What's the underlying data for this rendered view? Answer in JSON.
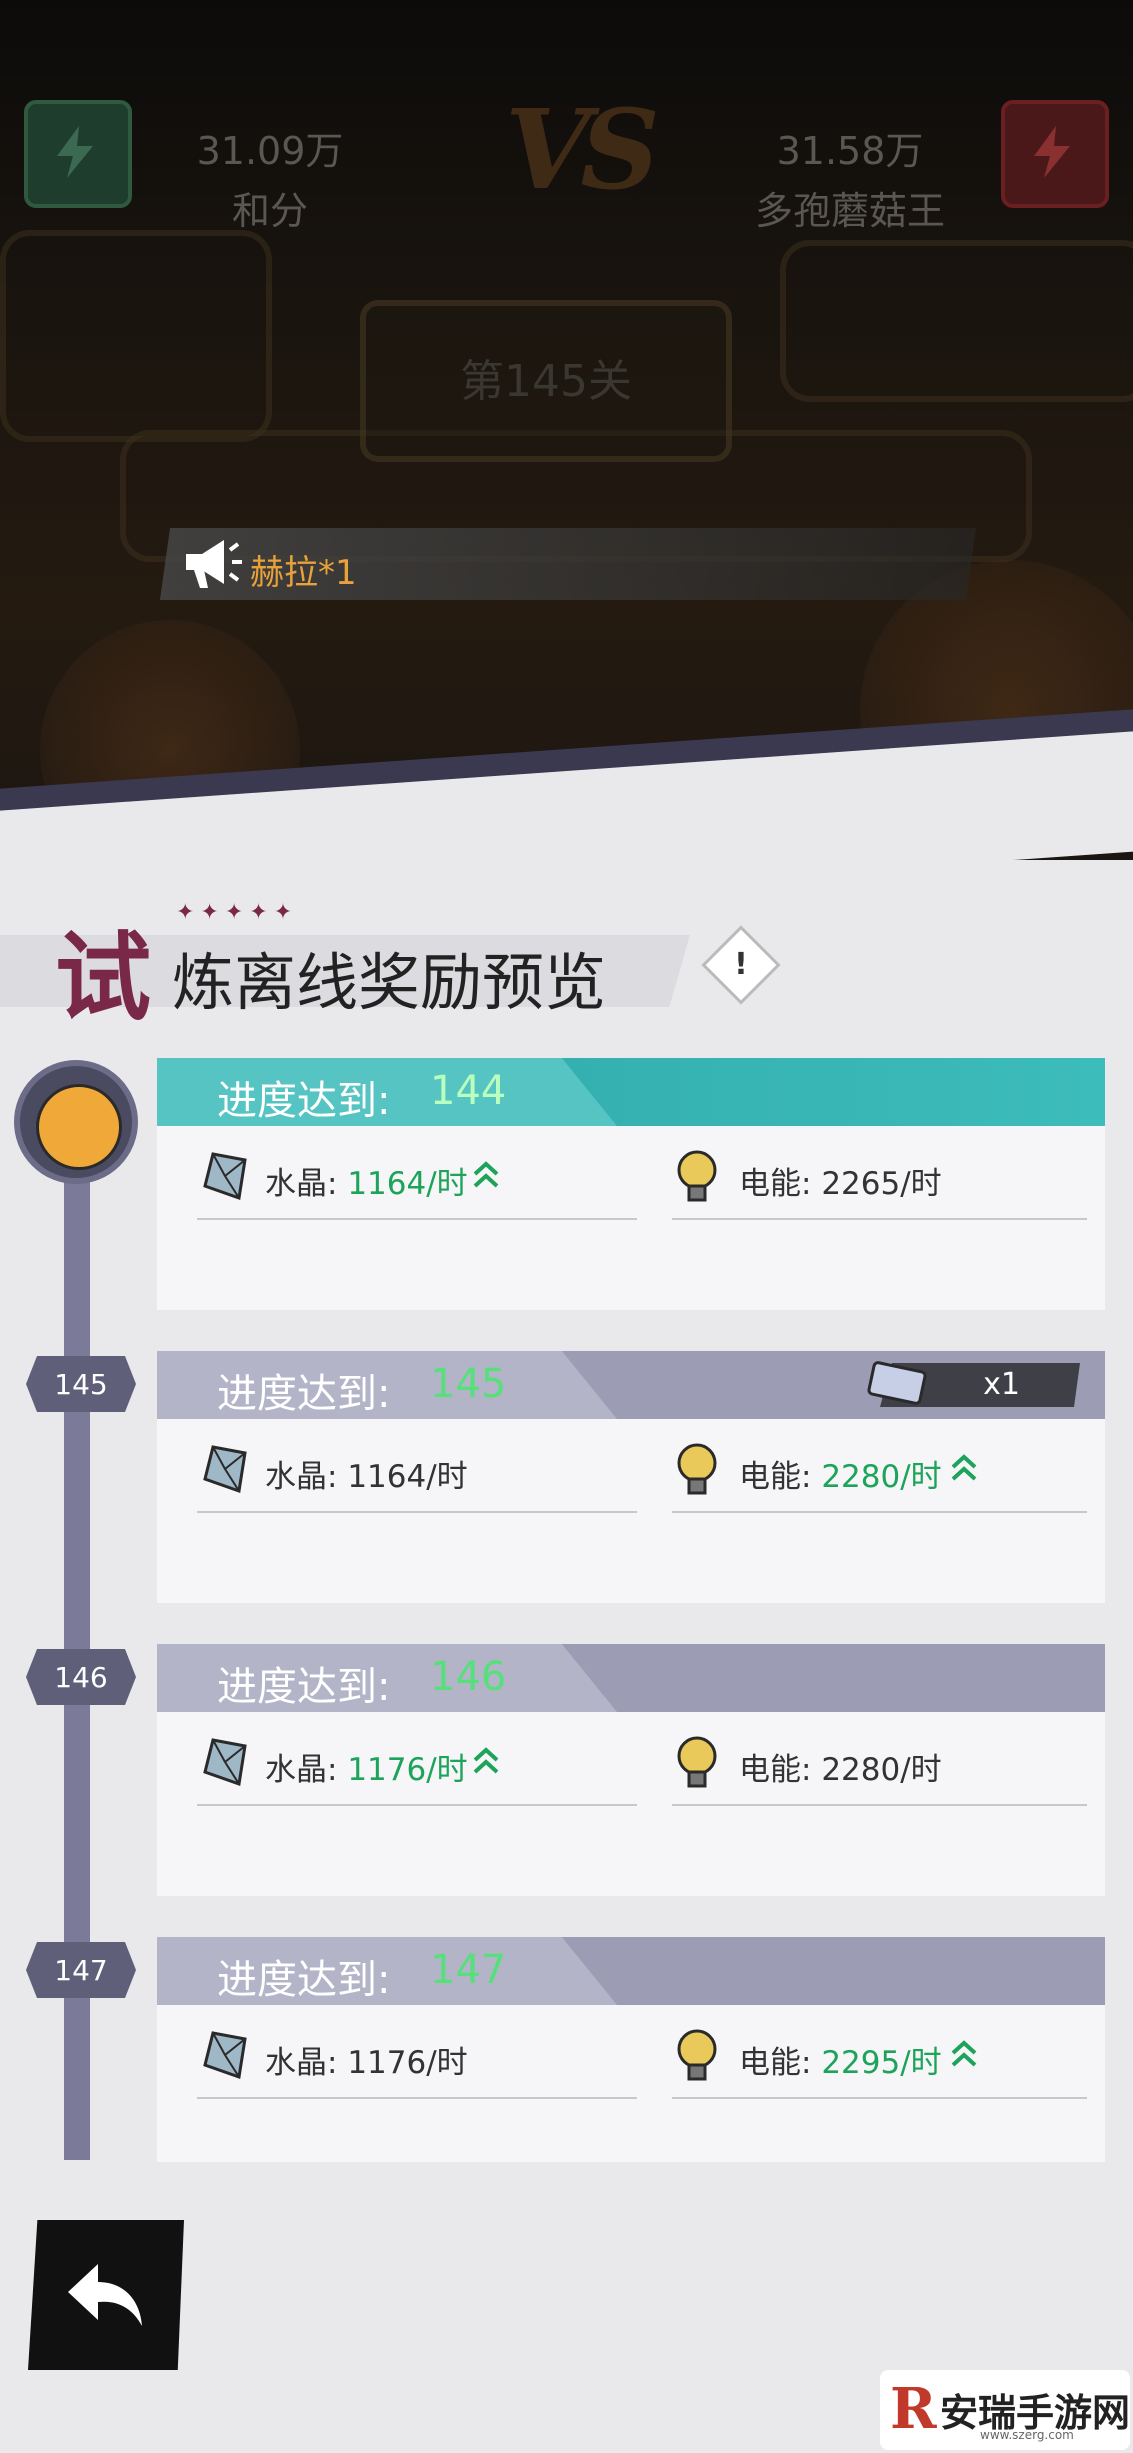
{
  "battle": {
    "left": {
      "score": "31.09万",
      "name": "和分"
    },
    "right": {
      "score": "31.58万",
      "name": "多孢蘑菇王"
    },
    "vs": "VS",
    "stage": "第145关",
    "notice": "赫拉*1"
  },
  "title": {
    "big": "试",
    "rest": "炼离线奖励预览",
    "info": "!"
  },
  "cards": [
    {
      "label": "进度达到:",
      "level": "144",
      "crystal": "水晶: ",
      "crystal_val": "1164/时",
      "crystal_up": true,
      "power": "电能: ",
      "power_val": "2265/时",
      "power_up": false
    },
    {
      "label": "进度达到:",
      "level": "145",
      "crystal": "水晶: ",
      "crystal_val": "1164/时",
      "crystal_up": false,
      "power": "电能: ",
      "power_val": "2280/时",
      "power_up": true,
      "badge": "x1"
    },
    {
      "label": "进度达到:",
      "level": "146",
      "crystal": "水晶: ",
      "crystal_val": "1176/时",
      "crystal_up": true,
      "power": "电能: ",
      "power_val": "2280/时",
      "power_up": false
    },
    {
      "label": "进度达到:",
      "level": "147",
      "crystal": "水晶: ",
      "crystal_val": "1176/时",
      "crystal_up": false,
      "power": "电能: ",
      "power_val": "2295/时",
      "power_up": true
    }
  ],
  "nodes": [
    "145",
    "146",
    "147"
  ],
  "watermark": {
    "logo": "R",
    "name": "安瑞手游网",
    "url": "www.szerg.com"
  },
  "colors": {
    "accent_teal": "#3cbcbb",
    "up_green": "#1ea35a",
    "title_red": "#7a2848"
  }
}
